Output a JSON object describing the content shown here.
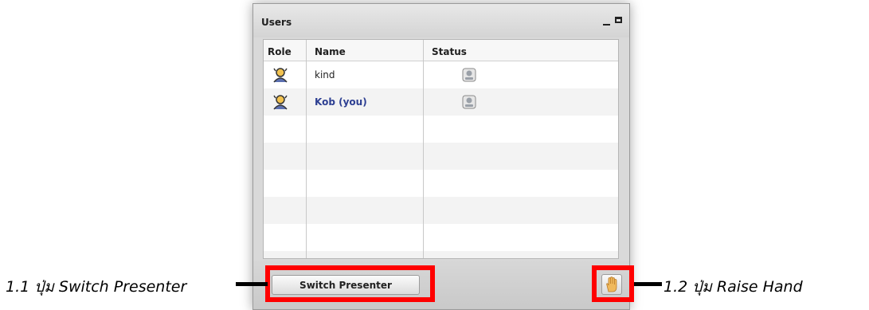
{
  "panel": {
    "title": "Users",
    "minimize_icon": "minimize-icon",
    "maximize_icon": "maximize-icon"
  },
  "table": {
    "columns": [
      "Role",
      "Name",
      "Status"
    ],
    "rows": [
      {
        "role_icon": "presenter-role-icon",
        "name": "kind",
        "is_you": false,
        "status_icon": "webcam-status-icon"
      },
      {
        "role_icon": "presenter-role-icon",
        "name": "Kob (you)",
        "is_you": true,
        "status_icon": "webcam-status-icon"
      }
    ]
  },
  "buttons": {
    "switch_presenter": "Switch Presenter",
    "raise_hand_icon": "raise-hand-icon"
  },
  "annotations": {
    "callout_switch": "1.1 ปุ่ม Switch Presenter",
    "callout_raise": "1.2 ปุ่ม Raise Hand",
    "highlight_color": "#ff0000"
  }
}
